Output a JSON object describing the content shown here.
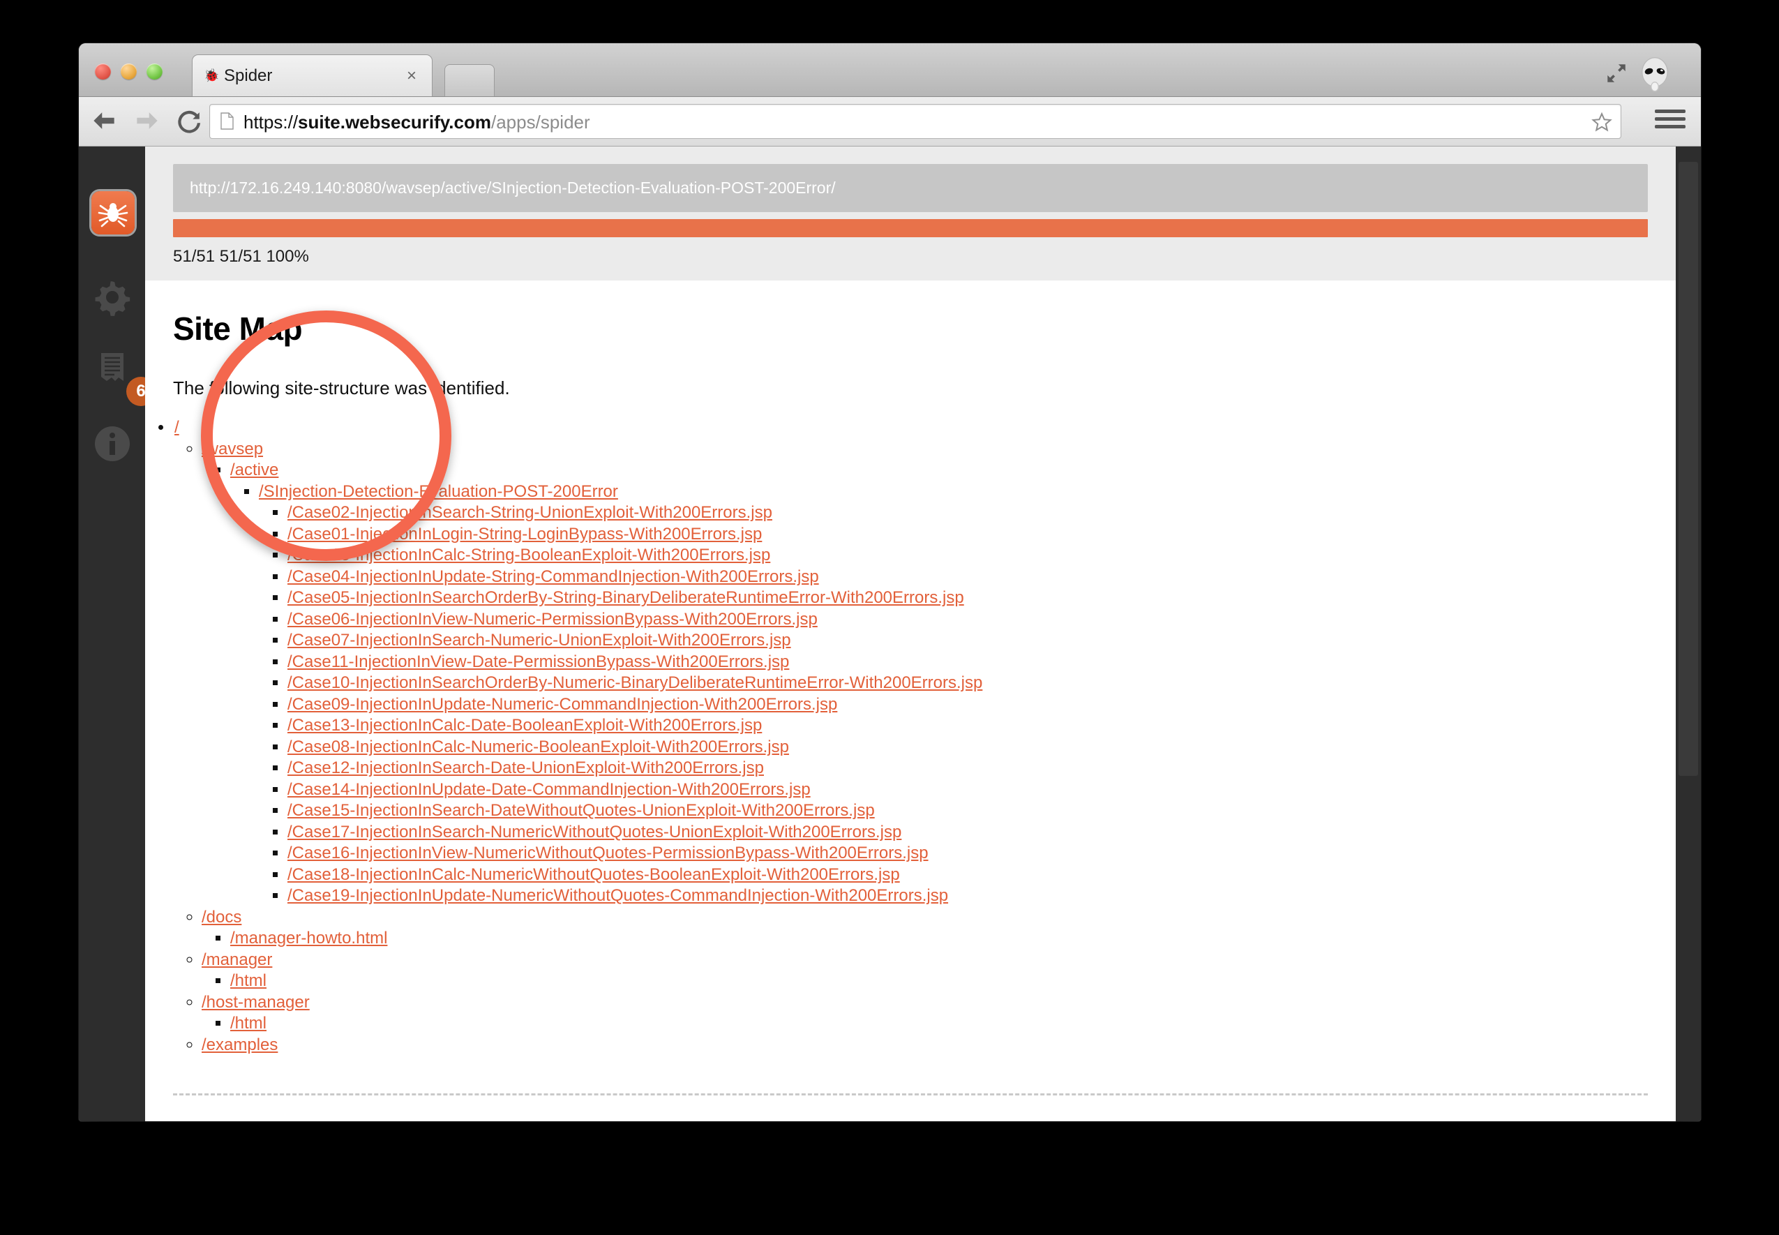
{
  "browser": {
    "tab": {
      "title": "Spider",
      "favicon": "spider-icon",
      "close_label": "×"
    },
    "url": {
      "scheme": "https://",
      "host": "suite.websecurify.com",
      "path": "/apps/spider",
      "full": "https://suite.websecurify.com/apps/spider"
    },
    "controls": {
      "back": "←",
      "forward": "→",
      "reload": "↻",
      "star": "star-icon",
      "menu": "menu-icon",
      "expand": "expand-icon",
      "avatar": "alien-icon"
    },
    "window_buttons": {
      "close": "close",
      "minimize": "minimize",
      "maximize": "maximize"
    }
  },
  "sidebar": {
    "items": [
      {
        "name": "spider",
        "icon": "spider-icon",
        "active": true
      },
      {
        "name": "settings",
        "icon": "gear-icon",
        "active": false
      },
      {
        "name": "report",
        "icon": "report-icon",
        "active": false,
        "badge": "6"
      },
      {
        "name": "info",
        "icon": "info-icon",
        "active": false
      }
    ]
  },
  "status": {
    "target_url": "http://172.16.249.140:8080/wavsep/active/SInjection-Detection-Evaluation-POST-200Error/",
    "progress_text": "51/51 51/51 100%",
    "progress_percent": 100
  },
  "page": {
    "title": "Site Map",
    "subtitle": "The following site-structure was identified."
  },
  "tree": {
    "root": "/",
    "wavsep": "/wavsep",
    "active": "/active",
    "sinjection": "/SInjection-Detection-Evaluation-POST-200Error",
    "cases": [
      "/Case02-InjectionInSearch-String-UnionExploit-With200Errors.jsp",
      "/Case01-InjectionInLogin-String-LoginBypass-With200Errors.jsp",
      "/Case03-InjectionInCalc-String-BooleanExploit-With200Errors.jsp",
      "/Case04-InjectionInUpdate-String-CommandInjection-With200Errors.jsp",
      "/Case05-InjectionInSearchOrderBy-String-BinaryDeliberateRuntimeError-With200Errors.jsp",
      "/Case06-InjectionInView-Numeric-PermissionBypass-With200Errors.jsp",
      "/Case07-InjectionInSearch-Numeric-UnionExploit-With200Errors.jsp",
      "/Case11-InjectionInView-Date-PermissionBypass-With200Errors.jsp",
      "/Case10-InjectionInSearchOrderBy-Numeric-BinaryDeliberateRuntimeError-With200Errors.jsp",
      "/Case09-InjectionInUpdate-Numeric-CommandInjection-With200Errors.jsp",
      "/Case13-InjectionInCalc-Date-BooleanExploit-With200Errors.jsp",
      "/Case08-InjectionInCalc-Numeric-BooleanExploit-With200Errors.jsp",
      "/Case12-InjectionInSearch-Date-UnionExploit-With200Errors.jsp",
      "/Case14-InjectionInUpdate-Date-CommandInjection-With200Errors.jsp",
      "/Case15-InjectionInSearch-DateWithoutQuotes-UnionExploit-With200Errors.jsp",
      "/Case17-InjectionInSearch-NumericWithoutQuotes-UnionExploit-With200Errors.jsp",
      "/Case16-InjectionInView-NumericWithoutQuotes-PermissionBypass-With200Errors.jsp",
      "/Case18-InjectionInCalc-NumericWithoutQuotes-BooleanExploit-With200Errors.jsp",
      "/Case19-InjectionInUpdate-NumericWithoutQuotes-CommandInjection-With200Errors.jsp"
    ],
    "docs": "/docs",
    "docs_child": "/manager-howto.html",
    "manager": "/manager",
    "manager_child": "/html",
    "host_manager": "/host-manager",
    "host_manager_child": "/html",
    "examples": "/examples"
  },
  "colors": {
    "accent": "#e2603a",
    "progress": "#e8724a",
    "annotation": "#f4674e",
    "sidebar_bg": "#2d2d2d",
    "status_bg": "#ebebeb",
    "target_bar": "#c6c6c6"
  }
}
